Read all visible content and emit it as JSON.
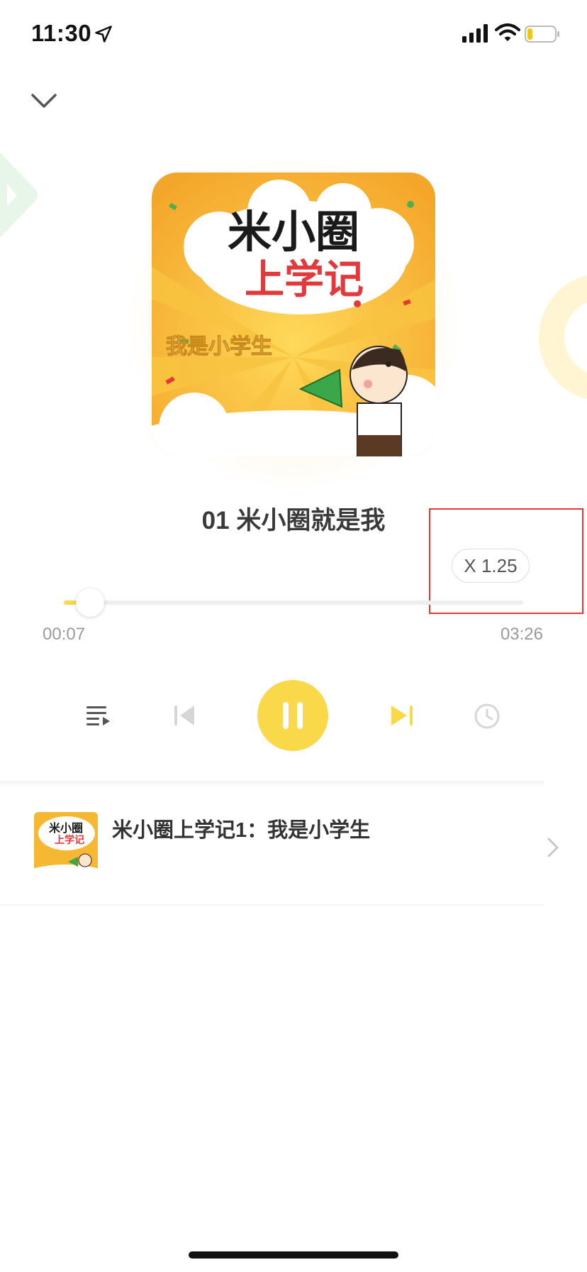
{
  "status_bar": {
    "time": "11:30"
  },
  "player": {
    "track_title": "01 米小圈就是我",
    "speed_label": "X 1.25",
    "current_time": "00:07",
    "total_time": "03:26",
    "progress_fraction": 0.035
  },
  "cover_art": {
    "title_line1": "米小圈",
    "title_line2": "上学记",
    "subtitle": "我是小学生"
  },
  "album": {
    "title": "米小圈上学记1：我是小学生"
  },
  "colors": {
    "accent_yellow": "#f9d84a",
    "highlight_red": "#e53935",
    "muted_gray": "#9a9a9a"
  },
  "icons": {
    "collapse": "chevron-down-icon",
    "playlist": "playlist-icon",
    "prev": "skip-previous-icon",
    "play_pause": "pause-icon",
    "next": "skip-next-icon",
    "timer": "clock-icon",
    "album_nav": "chevron-right-icon"
  }
}
